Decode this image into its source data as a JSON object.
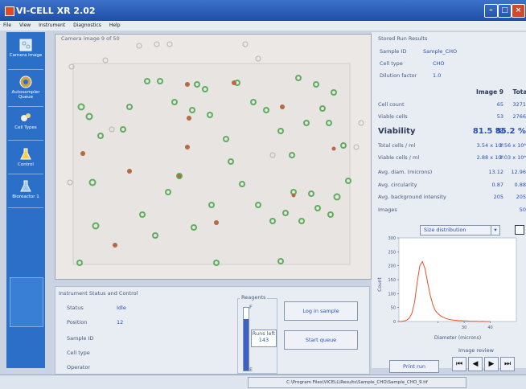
{
  "app": {
    "title": "VI-CELL XR 2.02"
  },
  "menu": [
    "File",
    "View",
    "Instrument",
    "Diagnostics",
    "Help"
  ],
  "sidebar": {
    "items": [
      {
        "label": "Camera image"
      },
      {
        "label": "Autosampler Queue"
      },
      {
        "label": "Cell Types"
      },
      {
        "label": "Control"
      },
      {
        "label": "Bioreactor 1"
      }
    ]
  },
  "camera": {
    "header": "Camera image 9 of 50"
  },
  "results": {
    "title": "Stored Run Results",
    "sample_id_label": "Sample ID",
    "sample_id": "Sample_CHO",
    "cell_type_label": "Cell type",
    "cell_type": "CHO",
    "dilution_label": "Dilution factor",
    "dilution": "1.0",
    "col_image": "Image 9",
    "col_total": "Total",
    "rows": [
      {
        "label": "Cell count",
        "image": "65",
        "total": "3271",
        "big": false
      },
      {
        "label": "Viable cells",
        "image": "53",
        "total": "2766",
        "big": false
      },
      {
        "label": "Viability",
        "image": "81.5 %",
        "total": "85.2 %",
        "big": true
      },
      {
        "label": "Total cells / ml",
        "image": "3.54 x 10⁶",
        "total": "3.56 x 10⁶",
        "big": false
      },
      {
        "label": "Viable cells / ml",
        "image": "2.88 x 10⁶",
        "total": "3.03 x 10⁶",
        "big": false
      },
      {
        "label": "Avg. diam. (microns)",
        "image": "13.12",
        "total": "12.96",
        "big": false
      },
      {
        "label": "Avg. circularity",
        "image": "0.87",
        "total": "0.88",
        "big": false
      },
      {
        "label": "Avg. background intensity",
        "image": "205",
        "total": "205",
        "big": false
      },
      {
        "label": "Images",
        "image": "",
        "total": "50",
        "big": false
      }
    ],
    "dropdown": "Size distribution"
  },
  "chart_data": {
    "type": "line",
    "title": "",
    "xlabel": "Diameter (microns)",
    "ylabel": "Count",
    "xlim": [
      5,
      50
    ],
    "ylim": [
      0,
      300
    ],
    "x_ticks": [
      20,
      30,
      40
    ],
    "x_tick_labels": [
      "",
      "30",
      "40"
    ],
    "y_ticks": [
      0,
      50,
      100,
      150,
      200,
      250,
      300
    ],
    "series": [
      {
        "color": "#e8502c",
        "x": [
          5,
          6,
          7,
          8,
          9,
          10,
          11,
          12,
          13,
          14,
          15,
          16,
          17,
          18,
          19,
          20,
          21,
          22,
          23,
          24,
          25,
          26,
          27,
          28,
          29,
          30,
          31,
          32,
          33,
          34,
          35,
          36,
          37,
          38,
          39,
          40
        ],
        "y": [
          0,
          0,
          2,
          5,
          12,
          30,
          70,
          140,
          200,
          215,
          190,
          140,
          95,
          60,
          38,
          28,
          20,
          15,
          11,
          8,
          6,
          5,
          4,
          3,
          3,
          2,
          2,
          1,
          1,
          1,
          1,
          0,
          1,
          0,
          0,
          0
        ]
      }
    ]
  },
  "status": {
    "title": "Instrument Status and Control",
    "status_label": "Status",
    "status_value": "Idle",
    "position_label": "Position",
    "position_value": "12",
    "sample_id_label": "Sample ID",
    "cell_type_label": "Cell type",
    "operator_label": "Operator"
  },
  "reagents": {
    "title": "Reagents",
    "full": "F",
    "empty": "E",
    "runs_left_label": "Runs left",
    "runs_left": "143",
    "fill_fraction": 0.82
  },
  "buttons": {
    "login": "Log in sample",
    "start": "Start queue",
    "print": "Print run"
  },
  "review": {
    "title": "Image review"
  },
  "statusbar": {
    "path": "C:\\Program Files\\VICELL\\Results\\Sample_CHO\\Sample_CHO_9.tif"
  },
  "colors": {
    "sidebar": "#2b6fc8",
    "curve": "#e8502c",
    "value_text": "#2b4fae",
    "live_cell": "#5cae5c",
    "dead_cell": "#b56a44"
  }
}
